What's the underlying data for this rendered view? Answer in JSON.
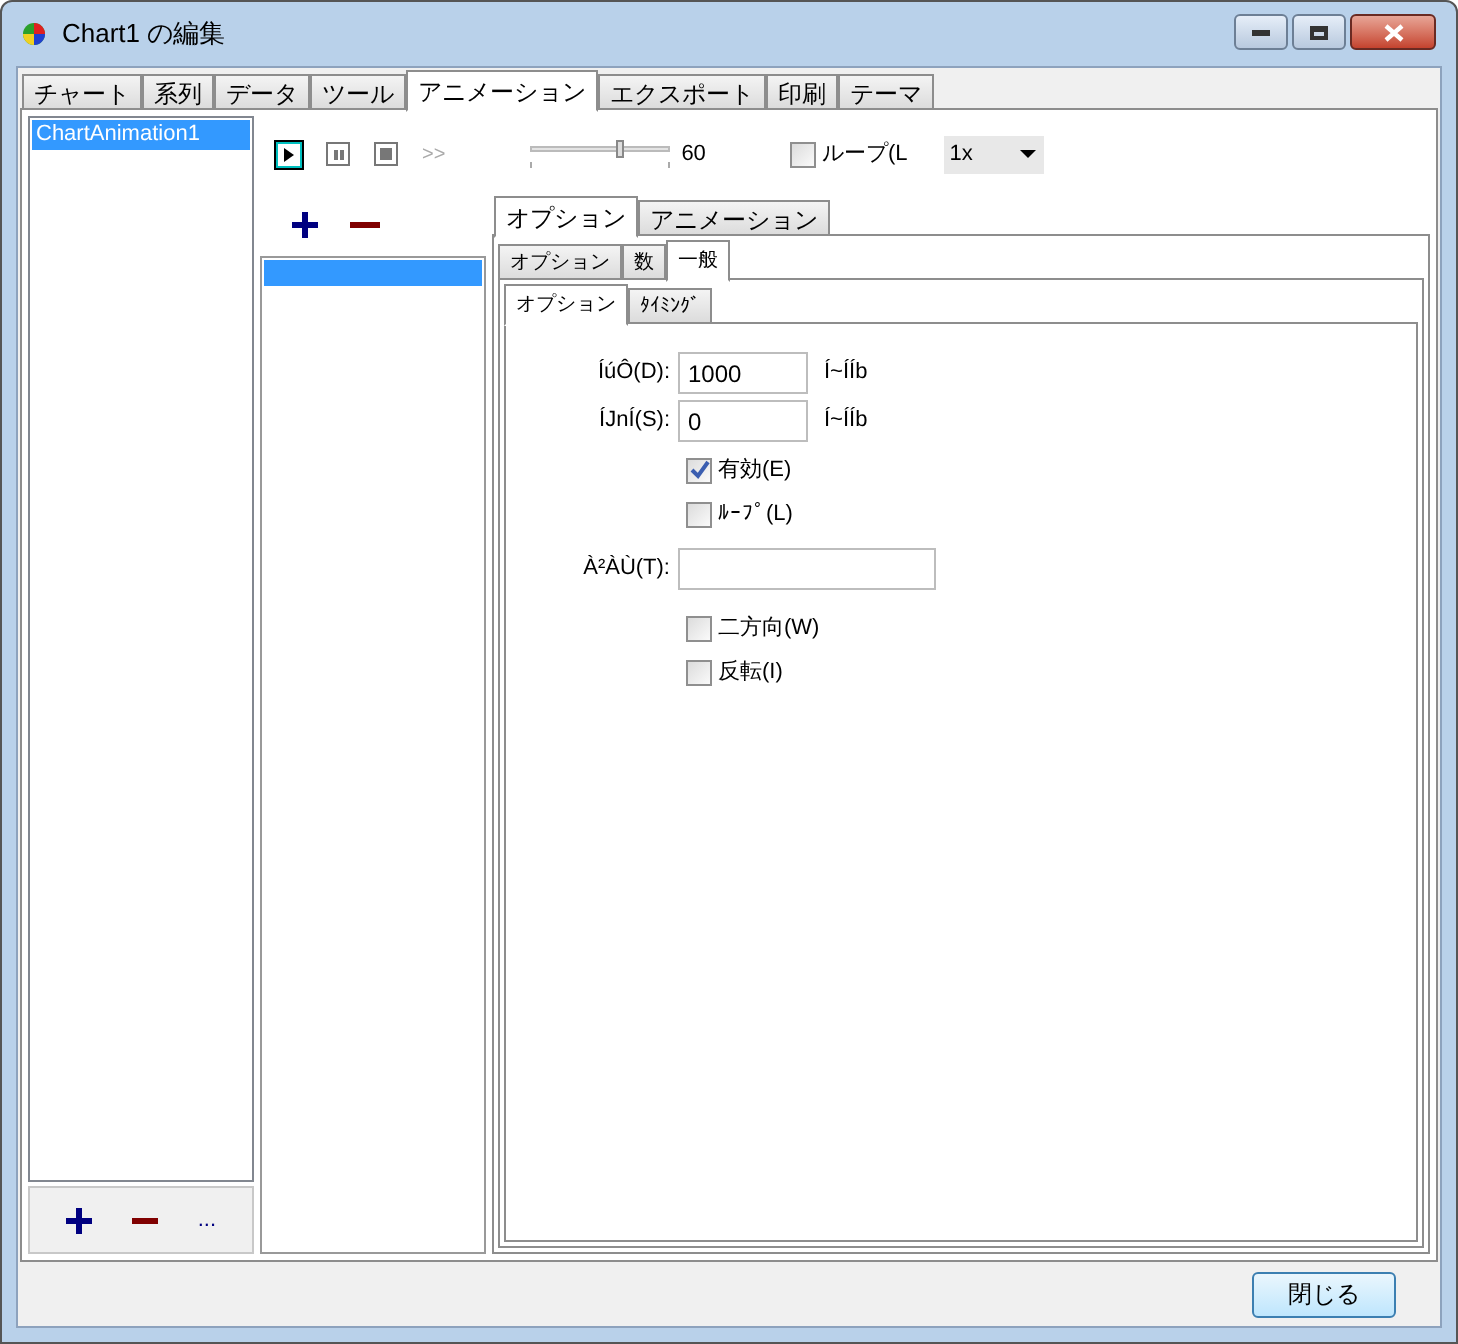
{
  "window": {
    "title": "Chart1 の編集"
  },
  "tabs": [
    {
      "label": "チャート",
      "selected": false
    },
    {
      "label": "系列",
      "selected": false
    },
    {
      "label": "データ",
      "selected": false
    },
    {
      "label": "ツール",
      "selected": false
    },
    {
      "label": "アニメーション",
      "selected": true
    },
    {
      "label": "エクスポート",
      "selected": false
    },
    {
      "label": "印刷",
      "selected": false
    },
    {
      "label": "テーマ",
      "selected": false
    }
  ],
  "animations": {
    "items": [
      {
        "label": "ChartAnimation1",
        "selected": true
      }
    ],
    "more": "..."
  },
  "toolbar": {
    "fps": "60",
    "level": 0.65,
    "loop": {
      "label": "ループ(L",
      "checked": false
    },
    "speed": "1x",
    "skip": ">>"
  },
  "steps": {
    "items": [
      {
        "selected": true
      }
    ]
  },
  "outer_tabs": [
    {
      "label": "オプション",
      "selected": true
    },
    {
      "label": "アニメーション",
      "selected": false
    }
  ],
  "middle_tabs": [
    {
      "label": "オプション",
      "selected": false
    },
    {
      "label": "数",
      "selected": false
    },
    {
      "label": "一般",
      "selected": true
    }
  ],
  "inner_tabs": [
    {
      "label": "オプション",
      "selected": true
    },
    {
      "label": "ﾀｲﾐﾝｸﾞ",
      "selected": false
    }
  ],
  "form": [
    {
      "kind": "number",
      "label": "ÍúÔ(D):",
      "value": "1000",
      "unit": "Í~ÍÍb"
    },
    {
      "kind": "number",
      "label": "ÍJnÍ(S):",
      "value": "0",
      "unit": "Í~ÍÍb"
    },
    {
      "kind": "check",
      "label": "有効(E)",
      "checked": true
    },
    {
      "kind": "check",
      "label": "ﾙｰﾌﾟ(L)",
      "checked": false
    },
    {
      "kind": "text",
      "label": "À²ÀÙ(T):"
    },
    {
      "kind": "check",
      "label": "二方向(W)",
      "checked": false
    },
    {
      "kind": "check",
      "label": "反転(I)",
      "checked": false
    }
  ],
  "close_button": "閉じる"
}
